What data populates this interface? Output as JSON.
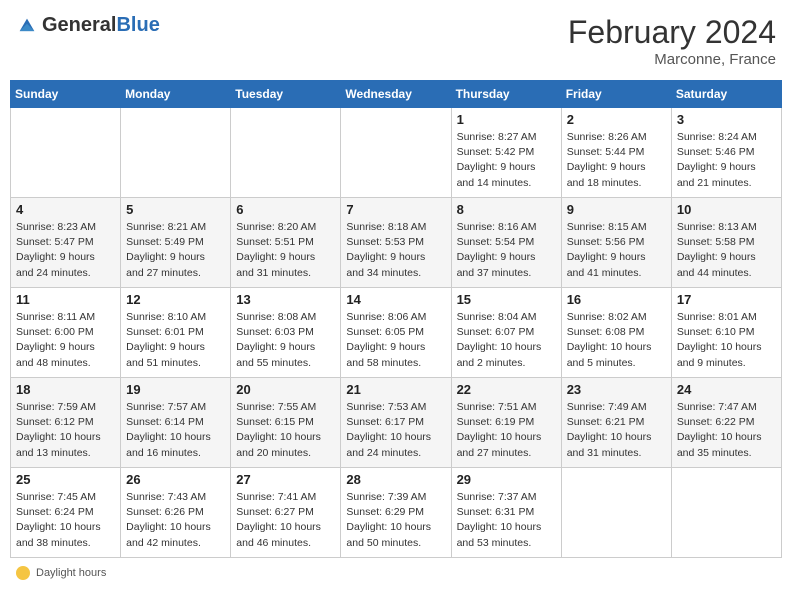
{
  "header": {
    "logo_general": "General",
    "logo_blue": "Blue",
    "month_year": "February 2024",
    "location": "Marconne, France"
  },
  "legend": {
    "label": "Daylight hours"
  },
  "weekdays": [
    "Sunday",
    "Monday",
    "Tuesday",
    "Wednesday",
    "Thursday",
    "Friday",
    "Saturday"
  ],
  "weeks": [
    [
      {
        "day": "",
        "info": ""
      },
      {
        "day": "",
        "info": ""
      },
      {
        "day": "",
        "info": ""
      },
      {
        "day": "",
        "info": ""
      },
      {
        "day": "1",
        "info": "Sunrise: 8:27 AM\nSunset: 5:42 PM\nDaylight: 9 hours\nand 14 minutes."
      },
      {
        "day": "2",
        "info": "Sunrise: 8:26 AM\nSunset: 5:44 PM\nDaylight: 9 hours\nand 18 minutes."
      },
      {
        "day": "3",
        "info": "Sunrise: 8:24 AM\nSunset: 5:46 PM\nDaylight: 9 hours\nand 21 minutes."
      }
    ],
    [
      {
        "day": "4",
        "info": "Sunrise: 8:23 AM\nSunset: 5:47 PM\nDaylight: 9 hours\nand 24 minutes."
      },
      {
        "day": "5",
        "info": "Sunrise: 8:21 AM\nSunset: 5:49 PM\nDaylight: 9 hours\nand 27 minutes."
      },
      {
        "day": "6",
        "info": "Sunrise: 8:20 AM\nSunset: 5:51 PM\nDaylight: 9 hours\nand 31 minutes."
      },
      {
        "day": "7",
        "info": "Sunrise: 8:18 AM\nSunset: 5:53 PM\nDaylight: 9 hours\nand 34 minutes."
      },
      {
        "day": "8",
        "info": "Sunrise: 8:16 AM\nSunset: 5:54 PM\nDaylight: 9 hours\nand 37 minutes."
      },
      {
        "day": "9",
        "info": "Sunrise: 8:15 AM\nSunset: 5:56 PM\nDaylight: 9 hours\nand 41 minutes."
      },
      {
        "day": "10",
        "info": "Sunrise: 8:13 AM\nSunset: 5:58 PM\nDaylight: 9 hours\nand 44 minutes."
      }
    ],
    [
      {
        "day": "11",
        "info": "Sunrise: 8:11 AM\nSunset: 6:00 PM\nDaylight: 9 hours\nand 48 minutes."
      },
      {
        "day": "12",
        "info": "Sunrise: 8:10 AM\nSunset: 6:01 PM\nDaylight: 9 hours\nand 51 minutes."
      },
      {
        "day": "13",
        "info": "Sunrise: 8:08 AM\nSunset: 6:03 PM\nDaylight: 9 hours\nand 55 minutes."
      },
      {
        "day": "14",
        "info": "Sunrise: 8:06 AM\nSunset: 6:05 PM\nDaylight: 9 hours\nand 58 minutes."
      },
      {
        "day": "15",
        "info": "Sunrise: 8:04 AM\nSunset: 6:07 PM\nDaylight: 10 hours\nand 2 minutes."
      },
      {
        "day": "16",
        "info": "Sunrise: 8:02 AM\nSunset: 6:08 PM\nDaylight: 10 hours\nand 5 minutes."
      },
      {
        "day": "17",
        "info": "Sunrise: 8:01 AM\nSunset: 6:10 PM\nDaylight: 10 hours\nand 9 minutes."
      }
    ],
    [
      {
        "day": "18",
        "info": "Sunrise: 7:59 AM\nSunset: 6:12 PM\nDaylight: 10 hours\nand 13 minutes."
      },
      {
        "day": "19",
        "info": "Sunrise: 7:57 AM\nSunset: 6:14 PM\nDaylight: 10 hours\nand 16 minutes."
      },
      {
        "day": "20",
        "info": "Sunrise: 7:55 AM\nSunset: 6:15 PM\nDaylight: 10 hours\nand 20 minutes."
      },
      {
        "day": "21",
        "info": "Sunrise: 7:53 AM\nSunset: 6:17 PM\nDaylight: 10 hours\nand 24 minutes."
      },
      {
        "day": "22",
        "info": "Sunrise: 7:51 AM\nSunset: 6:19 PM\nDaylight: 10 hours\nand 27 minutes."
      },
      {
        "day": "23",
        "info": "Sunrise: 7:49 AM\nSunset: 6:21 PM\nDaylight: 10 hours\nand 31 minutes."
      },
      {
        "day": "24",
        "info": "Sunrise: 7:47 AM\nSunset: 6:22 PM\nDaylight: 10 hours\nand 35 minutes."
      }
    ],
    [
      {
        "day": "25",
        "info": "Sunrise: 7:45 AM\nSunset: 6:24 PM\nDaylight: 10 hours\nand 38 minutes."
      },
      {
        "day": "26",
        "info": "Sunrise: 7:43 AM\nSunset: 6:26 PM\nDaylight: 10 hours\nand 42 minutes."
      },
      {
        "day": "27",
        "info": "Sunrise: 7:41 AM\nSunset: 6:27 PM\nDaylight: 10 hours\nand 46 minutes."
      },
      {
        "day": "28",
        "info": "Sunrise: 7:39 AM\nSunset: 6:29 PM\nDaylight: 10 hours\nand 50 minutes."
      },
      {
        "day": "29",
        "info": "Sunrise: 7:37 AM\nSunset: 6:31 PM\nDaylight: 10 hours\nand 53 minutes."
      },
      {
        "day": "",
        "info": ""
      },
      {
        "day": "",
        "info": ""
      }
    ]
  ]
}
